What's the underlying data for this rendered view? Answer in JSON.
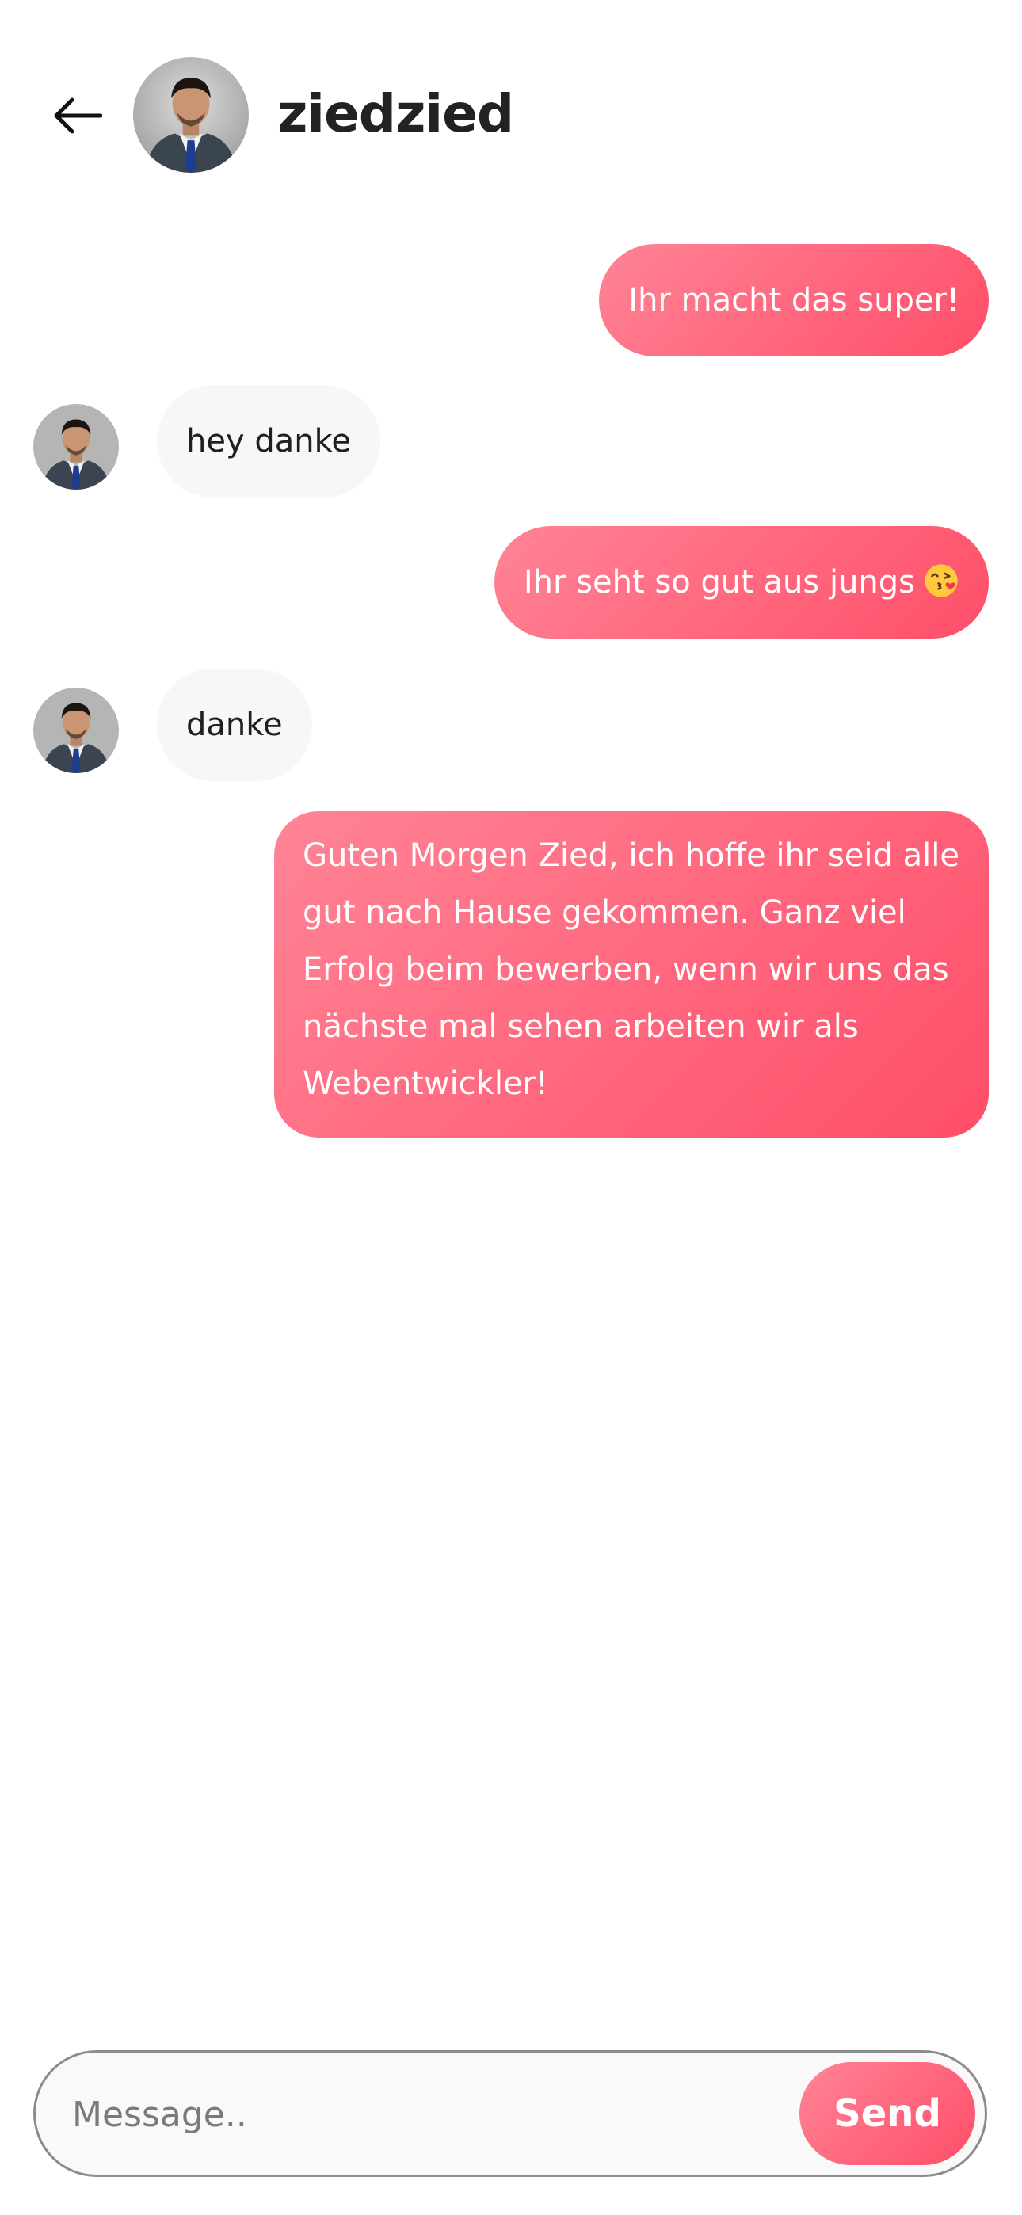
{
  "header": {
    "contact_name": "ziedzied"
  },
  "messages": [
    {
      "direction": "outgoing",
      "text": "Ihr macht das super!"
    },
    {
      "direction": "incoming",
      "text": "hey danke"
    },
    {
      "direction": "outgoing",
      "text": "Ihr seht so gut aus jungs",
      "emoji": "face-blowing-kiss"
    },
    {
      "direction": "incoming",
      "text": "danke"
    },
    {
      "direction": "outgoing",
      "text": "Guten Morgen Zied, ich hoffe ihr seid alle gut nach Hause gekommen. Ganz viel Erfolg beim bewerben, wenn wir uns das nächste mal sehen arbeiten wir als Webentwickler!"
    }
  ],
  "composer": {
    "placeholder": "Message..",
    "value": "",
    "send_label": "Send"
  },
  "colors": {
    "accent_start": "#ff8496",
    "accent_end": "#ff4e69",
    "incoming_bubble": "#f7f7f7"
  },
  "icons": {
    "back": "arrow-left-icon",
    "avatar": "avatar"
  }
}
